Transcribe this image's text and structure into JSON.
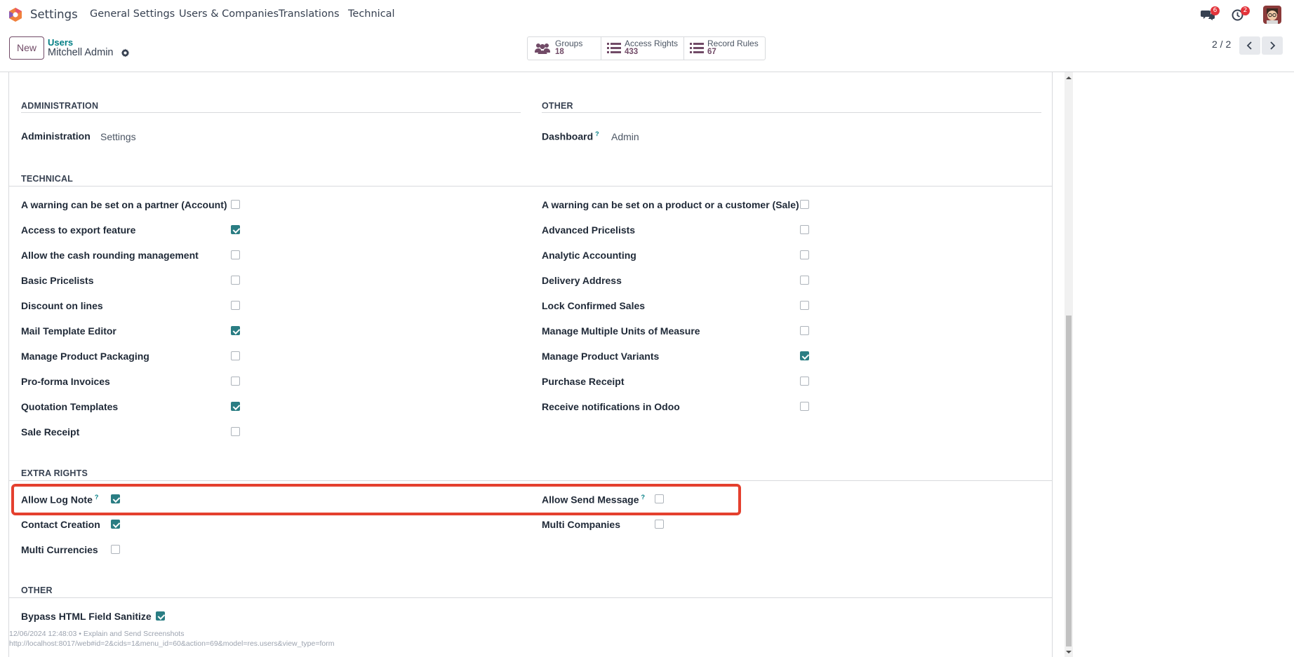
{
  "navbar": {
    "app_name": "Settings",
    "menus": [
      "General Settings",
      "Users & Companies",
      "Translations",
      "Technical"
    ],
    "messages_badge": "6",
    "activities_badge": "2"
  },
  "control": {
    "new_label": "New",
    "breadcrumb_parent": "Users",
    "breadcrumb_current": "Mitchell Admin",
    "smart_buttons": [
      {
        "label": "Groups",
        "count": "18",
        "icon": "users-icon"
      },
      {
        "label": "Access Rights",
        "count": "433",
        "icon": "list-icon"
      },
      {
        "label": "Record Rules",
        "count": "67",
        "icon": "list-icon"
      }
    ],
    "pager": "2 / 2"
  },
  "sections": {
    "administration": {
      "title": "ADMINISTRATION",
      "label": "Administration",
      "value": "Settings"
    },
    "other_top": {
      "title": "OTHER",
      "label": "Dashboard",
      "help": "?",
      "value": "Admin"
    },
    "technical": {
      "title": "TECHNICAL",
      "left": [
        {
          "label": "A warning can be set on a partner (Account)",
          "checked": false
        },
        {
          "label": "Access to export feature",
          "checked": true
        },
        {
          "label": "Allow the cash rounding management",
          "checked": false
        },
        {
          "label": "Basic Pricelists",
          "checked": false
        },
        {
          "label": "Discount on lines",
          "checked": false
        },
        {
          "label": "Mail Template Editor",
          "checked": true
        },
        {
          "label": "Manage Product Packaging",
          "checked": false
        },
        {
          "label": "Pro-forma Invoices",
          "checked": false
        },
        {
          "label": "Quotation Templates",
          "checked": true
        },
        {
          "label": "Sale Receipt",
          "checked": false
        }
      ],
      "right": [
        {
          "label": "A warning can be set on a product or a customer (Sale)",
          "checked": false
        },
        {
          "label": "Advanced Pricelists",
          "checked": false
        },
        {
          "label": "Analytic Accounting",
          "checked": false
        },
        {
          "label": "Delivery Address",
          "checked": false
        },
        {
          "label": "Lock Confirmed Sales",
          "checked": false
        },
        {
          "label": "Manage Multiple Units of Measure",
          "checked": false
        },
        {
          "label": "Manage Product Variants",
          "checked": true
        },
        {
          "label": "Purchase Receipt",
          "checked": false
        },
        {
          "label": "Receive notifications in Odoo",
          "checked": false
        }
      ]
    },
    "extra_rights": {
      "title": "EXTRA RIGHTS",
      "left": [
        {
          "label": "Allow Log Note",
          "help": "?",
          "checked": true
        },
        {
          "label": "Contact Creation",
          "help": "",
          "checked": true
        },
        {
          "label": "Multi Currencies",
          "help": "",
          "checked": false
        }
      ],
      "right": [
        {
          "label": "Allow Send Message",
          "help": "?",
          "checked": false
        },
        {
          "label": "Multi Companies",
          "help": "",
          "checked": false
        }
      ]
    },
    "other_bottom": {
      "title": "OTHER",
      "label": "Bypass HTML Field Sanitize",
      "checked": true
    }
  },
  "footer": {
    "line1": "12/06/2024 12:48:03 • Explain and Send Screenshots",
    "line2": "http://localhost:8017/web#id=2&cids=1&menu_id=60&action=69&model=res.users&view_type=form"
  },
  "colors": {
    "brand": "#714b67",
    "accent": "#017e84",
    "checkbox_checked": "#2a7d83",
    "highlight": "#e4402e",
    "badge": "#e3343b"
  }
}
